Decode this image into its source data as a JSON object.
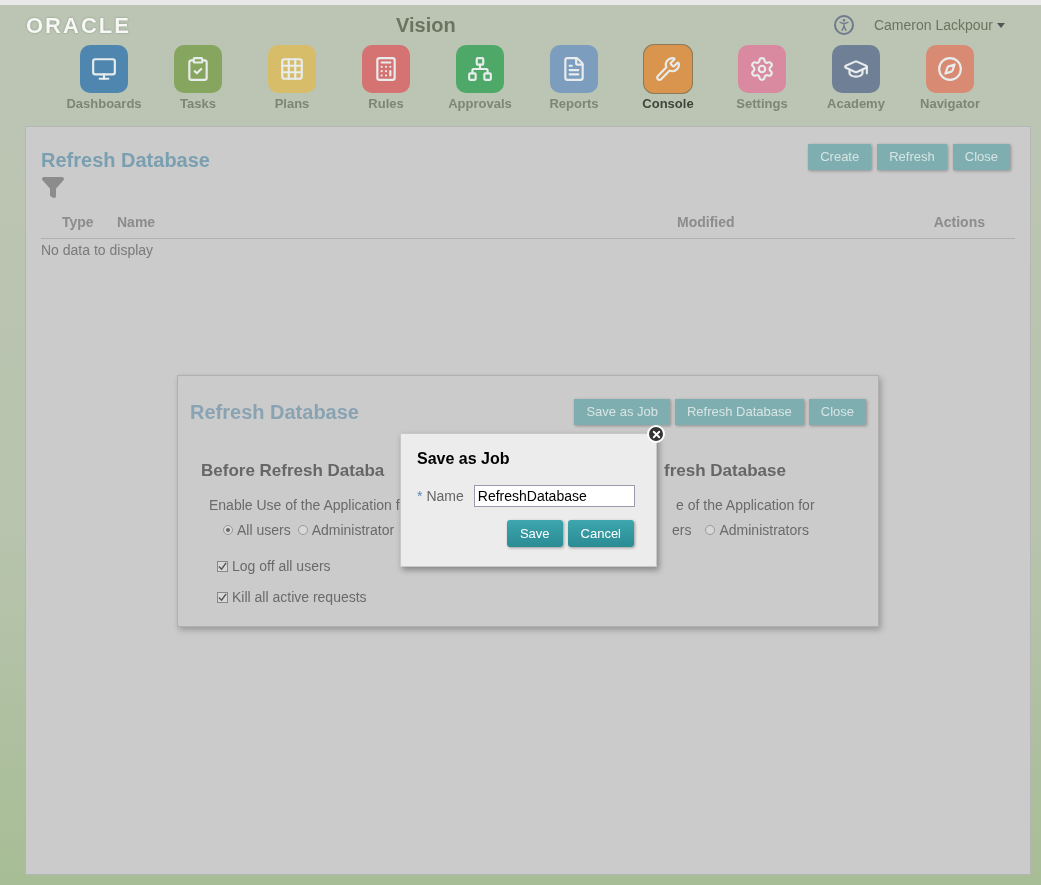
{
  "header": {
    "logo": "ORACLE",
    "title": "Vision",
    "user": "Cameron Lackpour"
  },
  "nav": [
    {
      "label": "Dashboards",
      "color": "#4f86b0",
      "selected": false
    },
    {
      "label": "Tasks",
      "color": "#86a55e",
      "selected": false
    },
    {
      "label": "Plans",
      "color": "#d7bd6a",
      "selected": false
    },
    {
      "label": "Rules",
      "color": "#d57272",
      "selected": false
    },
    {
      "label": "Approvals",
      "color": "#4ea868",
      "selected": false
    },
    {
      "label": "Reports",
      "color": "#7d9dbf",
      "selected": false
    },
    {
      "label": "Console",
      "color": "#d9954e",
      "selected": true
    },
    {
      "label": "Settings",
      "color": "#d98aa0",
      "selected": false
    },
    {
      "label": "Academy",
      "color": "#6f7f96",
      "selected": false
    },
    {
      "label": "Navigator",
      "color": "#d98a72",
      "selected": false
    }
  ],
  "panel": {
    "title": "Refresh Database",
    "buttons": [
      "Create",
      "Refresh",
      "Close"
    ],
    "table": {
      "columns": [
        "Type",
        "Name",
        "Modified",
        "Actions"
      ],
      "empty": "No data to display"
    }
  },
  "refresh_dialog": {
    "title": "Refresh Database",
    "buttons": [
      "Save as Job",
      "Refresh Database",
      "Close"
    ],
    "before": {
      "heading": "Before Refresh Databa",
      "label": "Enable Use of the Application f",
      "options": [
        {
          "label": "All users",
          "selected": true
        },
        {
          "label": "Administrator",
          "selected": false
        }
      ],
      "checks": [
        {
          "label": "Log off all users",
          "checked": true
        },
        {
          "label": "Kill all active requests",
          "checked": true
        }
      ]
    },
    "after": {
      "heading": "fresh Database",
      "label": "e of the Application for",
      "fragment": "ers",
      "options": [
        {
          "label": "Administrators",
          "selected": false
        }
      ]
    }
  },
  "save_dialog": {
    "title": "Save as Job",
    "field_label": "Name",
    "required_mark": "*",
    "value": "RefreshDatabase",
    "buttons": [
      "Save",
      "Cancel"
    ]
  }
}
